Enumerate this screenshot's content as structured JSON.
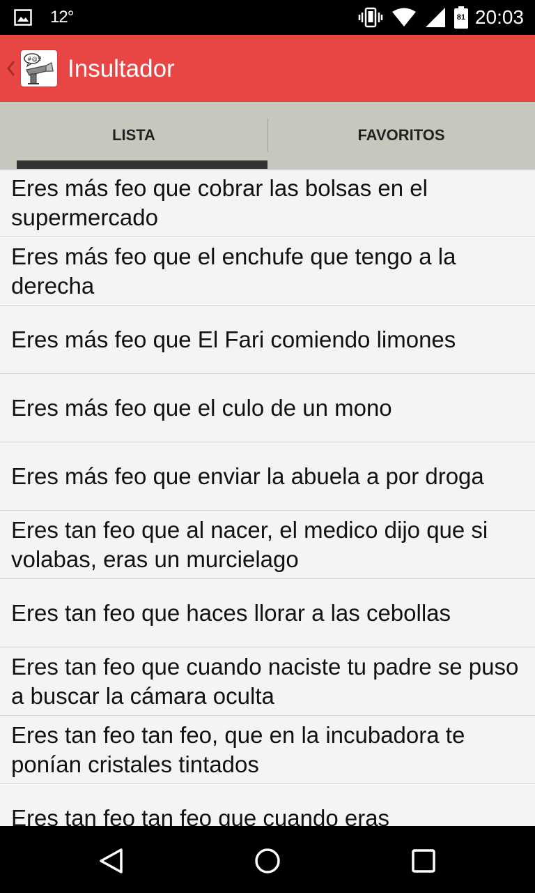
{
  "status_bar": {
    "temperature": "12°",
    "battery_level": "81",
    "time": "20:03"
  },
  "app_bar": {
    "title": "Insultador"
  },
  "tabs": [
    {
      "label": "LISTA",
      "selected": true
    },
    {
      "label": "FAVORITOS",
      "selected": false
    }
  ],
  "list": {
    "items": [
      "Eres más feo que cobrar las bolsas en el supermercado",
      "Eres más feo que el enchufe que tengo a la derecha",
      "Eres más feo que El Fari comiendo limones",
      "Eres más feo que el culo de un mono",
      "Eres más feo que enviar la abuela a por droga",
      "Eres tan feo que al nacer, el medico dijo que si volabas, eras un murcielago",
      "Eres tan feo que haces llorar a las cebollas",
      "Eres tan feo que cuando naciste tu padre se puso a buscar la cámara oculta",
      "Eres tan feo tan feo, que en la incubadora te ponían cristales tintados",
      "Eres tan feo tan feo que cuando eras"
    ]
  },
  "colors": {
    "app_bar": "#e84545",
    "tab_bar": "#c8c7bd",
    "indicator": "#333333"
  }
}
